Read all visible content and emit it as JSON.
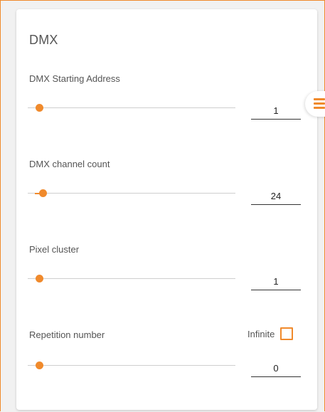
{
  "panel": {
    "title": "DMX"
  },
  "fields": [
    {
      "label": "DMX Starting Address",
      "value": "1",
      "slider_fraction": 0.0
    },
    {
      "label": "DMX channel count",
      "value": "24",
      "slider_fraction": 0.02
    },
    {
      "label": "Pixel cluster",
      "value": "1",
      "slider_fraction": 0.0
    },
    {
      "label": "Repetition number",
      "value": "0",
      "slider_fraction": 0.0
    }
  ],
  "infinite": {
    "label": "Infinite",
    "checked": false
  },
  "menu": {
    "icon": "hamburger-icon"
  },
  "colors": {
    "accent": "#f08a2c",
    "card": "#ffffff",
    "background": "#f1f1f1"
  }
}
